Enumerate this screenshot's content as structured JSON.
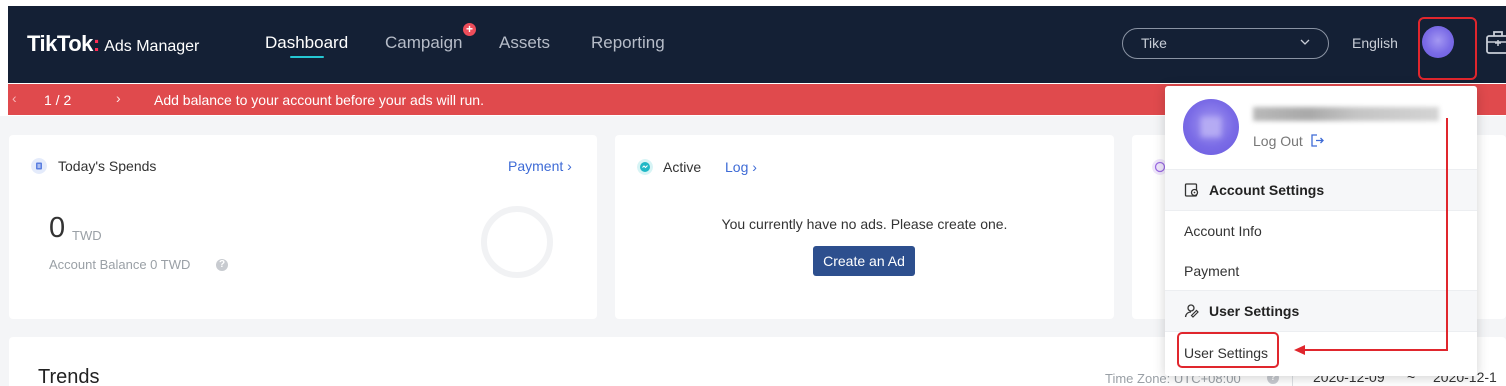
{
  "header": {
    "logo_brand": "TikTok",
    "logo_sep": ":",
    "logo_sub": "Ads Manager",
    "nav": {
      "dashboard": "Dashboard",
      "campaign": "Campaign",
      "assets": "Assets",
      "reporting": "Reporting"
    },
    "campaign_badge": "+",
    "account_select_value": "Tike",
    "language": "English"
  },
  "banner": {
    "pager": "1  /  2",
    "message": "Add balance to your account before your ads will run."
  },
  "spends_card": {
    "title": "Today's Spends",
    "link": "Payment",
    "amount": "0",
    "currency": "TWD",
    "balance": "Account Balance 0 TWD"
  },
  "active_card": {
    "title": "Active",
    "link": "Log",
    "empty_text": "You currently have no ads. Please create one.",
    "create_button": "Create an Ad"
  },
  "trends": {
    "title": "Trends",
    "timezone": "Time Zone: UTC+08:00",
    "date_start": "2020-12-09",
    "date_sep": "~",
    "date_end": "2020-12-1"
  },
  "dropdown": {
    "logout": "Log Out",
    "account_settings_header": "Account Settings",
    "account_info": "Account Info",
    "payment": "Payment",
    "user_settings_header": "User Settings",
    "user_settings": "User Settings"
  },
  "colors": {
    "nav_bg": "#142035",
    "banner_bg": "#e04a4d",
    "accent": "#25c7d3",
    "link": "#3e6bd6",
    "button": "#2d4f8e",
    "annotation": "#e0262d"
  }
}
